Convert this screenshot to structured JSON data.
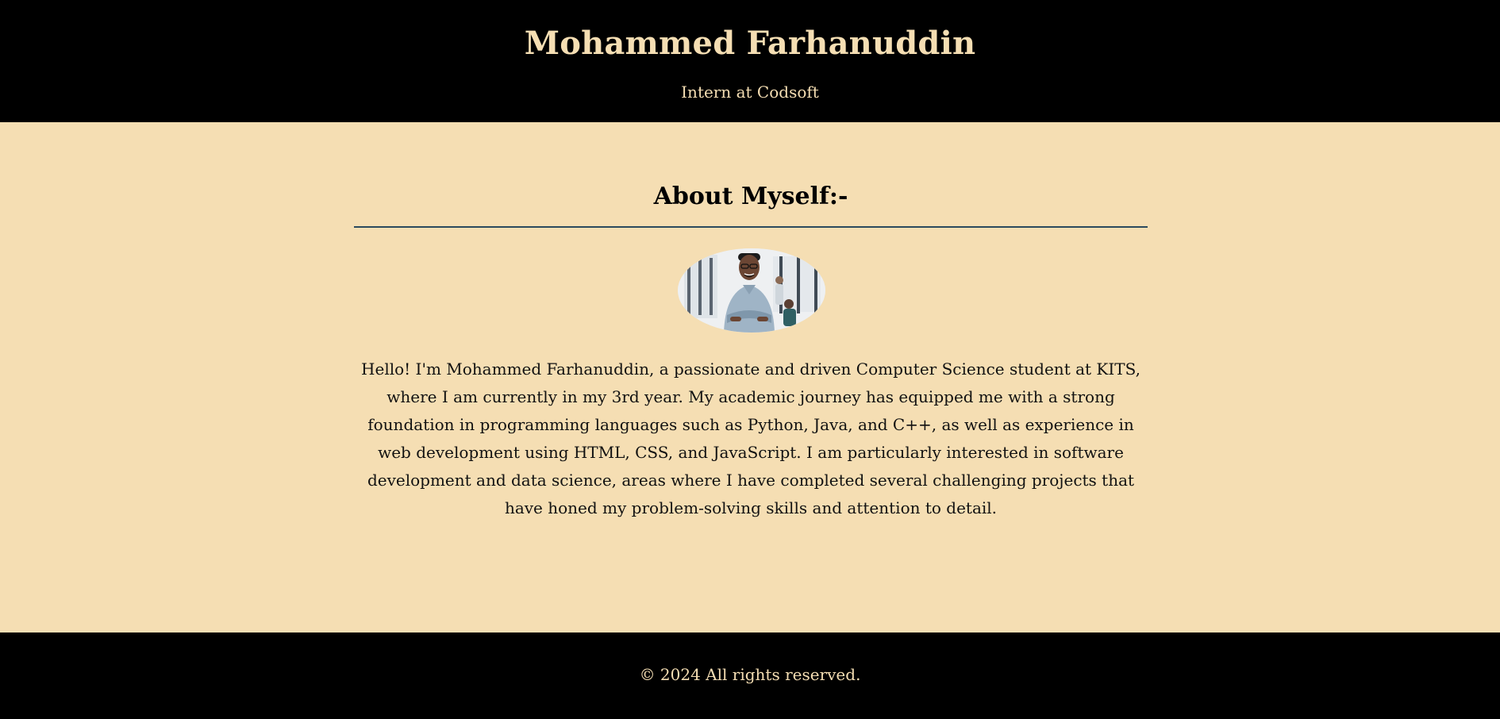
{
  "header": {
    "title": "Mohammed Farhanuddin",
    "subtitle": "Intern at Codsoft"
  },
  "about": {
    "heading": "About Myself:-",
    "avatar_alt": "Profile photo",
    "bio": "Hello! I'm Mohammed Farhanuddin, a passionate and driven Computer Science student at KITS, where I am currently in my 3rd year. My academic journey has equipped me with a strong foundation in programming languages such as Python, Java, and C++, as well as experience in web development using HTML, CSS, and JavaScript. I am particularly interested in software development and data science, areas where I have completed several challenging projects that have honed my problem-solving skills and attention to detail."
  },
  "footer": {
    "copyright": "© 2024 All rights reserved."
  },
  "colors": {
    "background": "#f5deb3",
    "header_bg": "#000000",
    "accent_text": "#f5deb3",
    "divider": "#2b4a5e"
  }
}
